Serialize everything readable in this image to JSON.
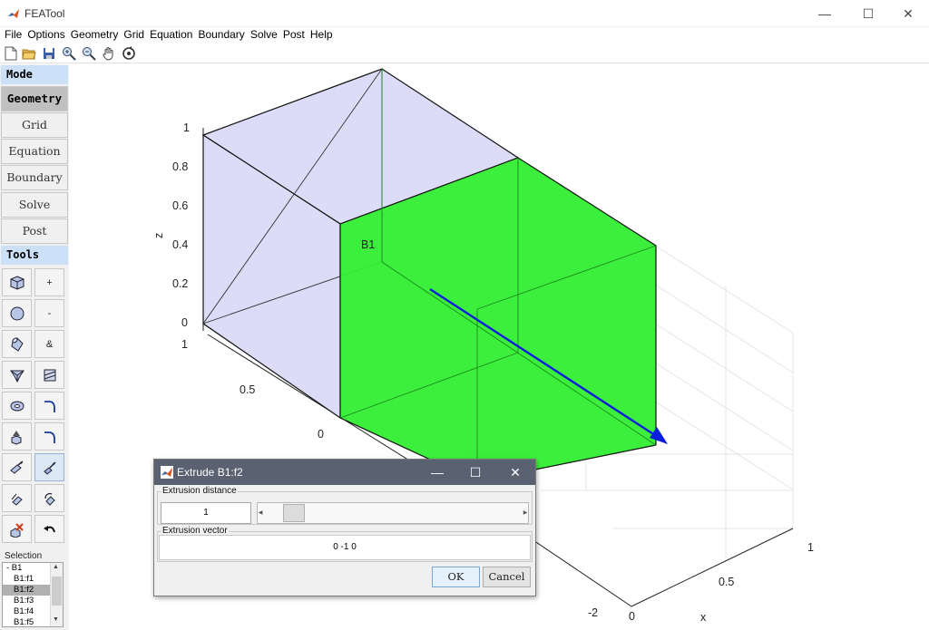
{
  "window": {
    "title": "FEATool",
    "minimize": "—",
    "maximize": "☐",
    "close": "✕"
  },
  "menu": [
    "File",
    "Options",
    "Geometry",
    "Grid",
    "Equation",
    "Boundary",
    "Solve",
    "Post",
    "Help"
  ],
  "toolbar_icons": [
    "new-file-icon",
    "open-folder-icon",
    "save-icon",
    "zoom-in-icon",
    "zoom-out-icon",
    "pan-hand-icon",
    "rotate-icon"
  ],
  "sidebar": {
    "mode_header": "Mode",
    "modes": [
      "Geometry",
      "Grid",
      "Equation",
      "Boundary",
      "Solve",
      "Post"
    ],
    "active_mode": "Geometry",
    "tools_header": "Tools",
    "tool_labels": {
      "add": "+",
      "subtract": "-",
      "intersect": "&"
    },
    "selection_label": "Selection",
    "selection_items": [
      "- B1",
      "B1:f1",
      "B1:f2",
      "B1:f3",
      "B1:f4",
      "B1:f5"
    ],
    "selected_item": "B1:f2"
  },
  "plot": {
    "zlabel": "z",
    "xlabel": "x",
    "z_ticks": [
      "1",
      "0.8",
      "0.6",
      "0.4",
      "0.2",
      "0"
    ],
    "y_ticks": [
      "1",
      "0.5",
      "0"
    ],
    "x_ticks": [
      "-2",
      "0",
      "0.5",
      "1"
    ],
    "object_label": "B1",
    "colors": {
      "face_highlight": "#33ee33",
      "face_normal": "#dcdcf8",
      "arrow": "#0a1edc"
    }
  },
  "dialog": {
    "title": "Extrude B1:f2",
    "minimize": "—",
    "maximize": "☐",
    "close": "✕",
    "distance_label": "Extrusion distance",
    "distance_value": "1",
    "vector_label": "Extrusion vector",
    "vector_value": "0  -1  0",
    "ok": "OK",
    "cancel": "Cancel"
  }
}
